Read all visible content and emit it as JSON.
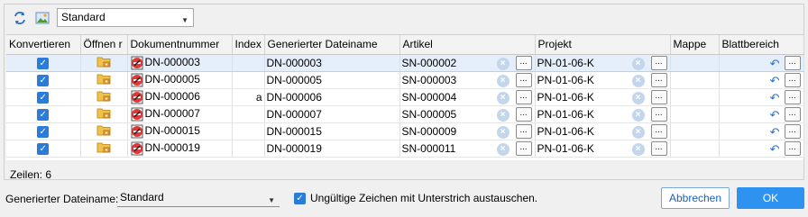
{
  "toolbar": {
    "refresh_icon": "refresh-arrows-icon",
    "view_icon": "image-preview-icon",
    "view_select": "Standard"
  },
  "table": {
    "columns": [
      "Konvertieren",
      "Öffnen r",
      "Dokumentnummer",
      "Index",
      "Generierter Dateiname",
      "Artikel",
      "Projekt",
      "Mappe",
      "Blattbereich"
    ],
    "rows": [
      {
        "convert": true,
        "doc": "DN-000003",
        "index": "",
        "filename": "DN-000003",
        "artikel": "SN-000002",
        "projekt": "PN-01-06-K",
        "mappe": "",
        "selected": true
      },
      {
        "convert": true,
        "doc": "DN-000005",
        "index": "",
        "filename": "DN-000005",
        "artikel": "SN-000003",
        "projekt": "PN-01-06-K",
        "mappe": "",
        "selected": false
      },
      {
        "convert": true,
        "doc": "DN-000006",
        "index": "a",
        "filename": "DN-000006",
        "artikel": "SN-000004",
        "projekt": "PN-01-06-K",
        "mappe": "",
        "selected": false
      },
      {
        "convert": true,
        "doc": "DN-000007",
        "index": "",
        "filename": "DN-000007",
        "artikel": "SN-000005",
        "projekt": "PN-01-06-K",
        "mappe": "",
        "selected": false
      },
      {
        "convert": true,
        "doc": "DN-000015",
        "index": "",
        "filename": "DN-000015",
        "artikel": "SN-000009",
        "projekt": "PN-01-06-K",
        "mappe": "",
        "selected": false
      },
      {
        "convert": true,
        "doc": "DN-000019",
        "index": "",
        "filename": "DN-000019",
        "artikel": "SN-000011",
        "projekt": "PN-01-06-K",
        "mappe": "",
        "selected": false
      }
    ],
    "ellipsis": "..."
  },
  "status": {
    "rows_label": "Zeilen: 6"
  },
  "footer": {
    "filename_label": "Generierter Dateiname:",
    "filename_select": "Standard",
    "replace_checked": true,
    "replace_label": "Ungültige Zeichen mit Unterstrich austauschen.",
    "cancel_label": "Abbrechen",
    "ok_label": "OK"
  },
  "colors": {
    "accent": "#2e93f0",
    "selection": "#e5eefb"
  }
}
